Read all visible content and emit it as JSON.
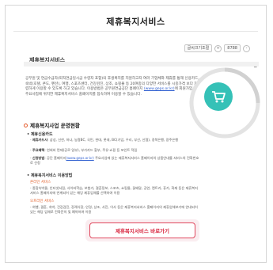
{
  "page": {
    "title": "제휴복지서비스"
  },
  "toolbar": {
    "text_size_label": "글씨크기조절",
    "plus_icon": "+",
    "percent": "8788",
    "minus_icon": "-"
  },
  "section": {
    "heading": "제휴복지서비스",
    "intro": "공무원 및 연금수급자(퇴직연금일시금 수령자 포함)의 후생복지를 지원하고자 여러 기업체와 제휴를 통해 신용카드, 숙박(호텔, 콘도, 펜션), 여행, 스포츠센터, 건강검진, 상조, 쇼핑몰 등 20여종의 다양한 서비스를 시중가격 보다 저렴하게 이용할 수 있도록 하고 있습니다. 이용방법은 공무원연금공단 홈페이지",
    "intro_link": "(www.geps.or.kr)",
    "intro_end": "에 회원가입 후 주요사업에 위치한 제휴복지서비스 홈페이지를 접속하여 이용할 수 있습니다."
  },
  "status": {
    "heading": "제휴복지사업 운영현황",
    "card_title": "제휴신용카드",
    "card_item1_label": "제휴카드사",
    "card_item1": ": 삼성, 신한, 하나, 농협BC, 국민, 현대, 롯데, BC(기업, 우리, 부산, 신협), 경북은행, 광주은행",
    "card_item2_label": "주요혜택",
    "card_item2": ": 연회비 면제(공로 일부), 부가카드 할부, 주유·쇼핑 등 포인트 적립",
    "card_item3_label": "신청방법",
    "card_item3_pre": ": 공단 홈페이지",
    "card_item3_link": "(www.geps.or.kr)",
    "card_item3_post": " 주요사업에 있는 제휴복지서비스 홈페이지의 상품안내를 서비스의 전화번호로 신청",
    "service_title": "제휴복지서비스 이용방법",
    "online_label": "온라인 서비스",
    "online_item": "- 종합숙박몰, 인터넷서점, 사이버학습, 보험가, 결혼정보, 스포츠, 쇼핑몰, 꽃배달, 공연, 렌트카, 휴가, 화재 등은 제휴복지서비스 홈페이지에 연계되어 있는 해당 제휴업체를 선택하여 이용",
    "offline_label": "오프라인 서비스",
    "offline_item": "- 여행, 결혼, 숙박, 건강검진, 장례식장, 안경, 상조, 사진, 이사 등은 제휴복지서비스 홈페이지의 제휴업체보기에 안내되어 있는 해당 업체로 전화문의 및 예약하여 이용"
  },
  "cta": {
    "label": "제휴복지서비스 바로가기"
  },
  "colors": {
    "accent": "#e0485e",
    "teal": "#35c1b7",
    "orange": "#e05a23",
    "link": "#2f5fd0"
  }
}
